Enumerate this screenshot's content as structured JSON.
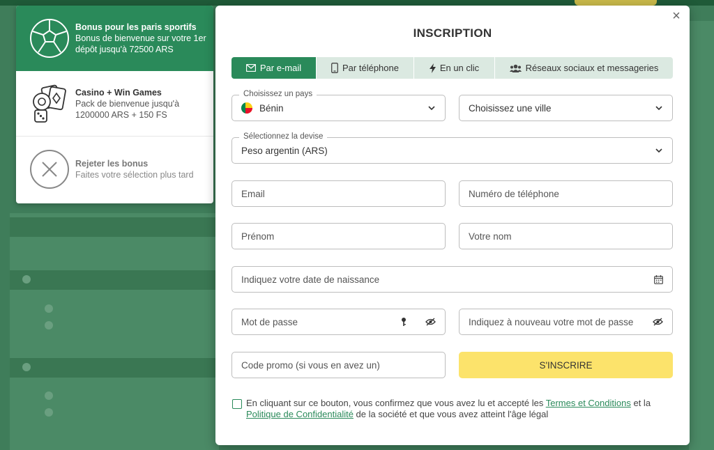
{
  "bonus": {
    "items": [
      {
        "title": "Bonus pour les paris sportifs",
        "desc": "Bonus de bienvenue sur votre 1er dépôt jusqu'à 72500 ARS",
        "icon": "soccer-ball-icon"
      },
      {
        "title": "Casino + Win Games",
        "desc": "Pack de bienvenue jusqu'à 1200000 ARS + 150 FS",
        "icon": "casino-cards-icon"
      },
      {
        "title": "Rejeter les bonus",
        "desc": "Faites votre sélection plus tard",
        "icon": "reject-icon"
      }
    ]
  },
  "modal": {
    "title": "INSCRIPTION",
    "close": "×",
    "tabs": [
      {
        "label": "Par e-mail",
        "icon": "envelope-icon"
      },
      {
        "label": "Par téléphone",
        "icon": "phone-icon"
      },
      {
        "label": "En un clic",
        "icon": "lightning-icon"
      },
      {
        "label": "Réseaux sociaux et messageries",
        "icon": "users-icon"
      }
    ],
    "form": {
      "country_label": "Choisissez un pays",
      "country_value": "Bénin",
      "city_placeholder": "Choisissez une ville",
      "currency_label": "Sélectionnez la devise",
      "currency_value": "Peso argentin (ARS)",
      "email_placeholder": "Email",
      "phone_placeholder": "Numéro de téléphone",
      "firstname_placeholder": "Prénom",
      "lastname_placeholder": "Votre nom",
      "dob_placeholder": "Indiquez votre date de naissance",
      "password_placeholder": "Mot de passe",
      "password_confirm_placeholder": "Indiquez à nouveau votre mot de passe",
      "promo_placeholder": "Code promo (si vous en avez un)",
      "submit_label": "S'INSCRIRE"
    },
    "consent": {
      "part1": "En cliquant sur ce bouton, vous confirmez que vous avez lu et accepté les ",
      "terms_link": "Termes et Conditions",
      "part2": " et la ",
      "privacy_link": "Politique de Confidentialité",
      "part3": " de la société et que vous avez atteint l'âge légal"
    }
  },
  "colors": {
    "brand_green": "#2a8a5a",
    "submit_yellow": "#fce36b",
    "tab_bg": "#dbe9e1"
  }
}
